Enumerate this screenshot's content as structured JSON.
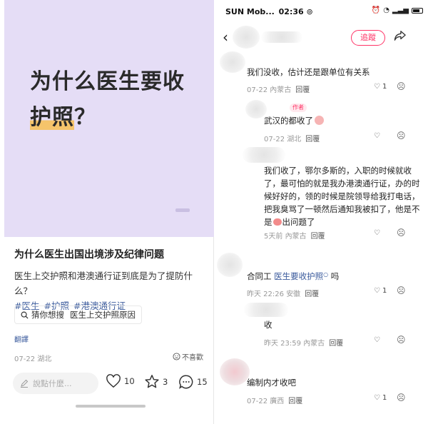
{
  "left": {
    "cover": {
      "line1": "为什么医生要收",
      "line2_highlight": "护照",
      "line2_rest": "？"
    },
    "post": {
      "title": "为什么医生出国出境涉及纪律问题",
      "body": "医生上交护照和港澳通行证到底是为了提防什么？",
      "tags": [
        "#医生",
        "#护照",
        "#港澳通行证"
      ],
      "guess_label": "猜你想搜",
      "guess_query": "医生上交护照原因",
      "translate": "翻譯",
      "date": "07-22 湖北",
      "dislike": "不喜歡"
    },
    "bar": {
      "say_placeholder": "說點什麼...",
      "likes": "10",
      "stars": "3",
      "comments": "15"
    }
  },
  "right": {
    "status": {
      "carrier": "SUN Mob...",
      "time": "02:36"
    },
    "follow_label": "追蹤",
    "comments": [
      {
        "text": "我们没收，估计还是跟单位有关系",
        "date": "07-22",
        "region": "內蒙古",
        "reply": "回覆",
        "likes": "1"
      },
      {
        "author_badge": "作者",
        "text": "武汉的都收了",
        "date": "07-22",
        "region": "湖北",
        "reply": "回覆",
        "likes": ""
      },
      {
        "text_lines": [
          "我们收了，鄂尔多斯的，入职的时候就收",
          "了，最可怕的就是我办港澳通行证，办的时",
          "候好好的，领的时候是院领导给我打电话，",
          "把我臭骂了一顿然后通知我被扣了，他是不",
          "是",
          "出问题了"
        ],
        "date": "5天前",
        "region": "內蒙古",
        "reply": "回覆",
        "likes": ""
      },
      {
        "text_prefix": "合同工",
        "text_link": "医生要收护照",
        "text_suffix": "吗",
        "date": "昨天 22:26",
        "region": "安徽",
        "reply": "回覆",
        "likes": "1"
      },
      {
        "text": "收",
        "date": "昨天 23:59",
        "region": "內蒙古",
        "reply": "回覆",
        "likes": ""
      },
      {
        "text": "编制内才收吧",
        "date": "07-22",
        "region": "廣西",
        "reply": "回覆",
        "likes": "1"
      }
    ]
  }
}
